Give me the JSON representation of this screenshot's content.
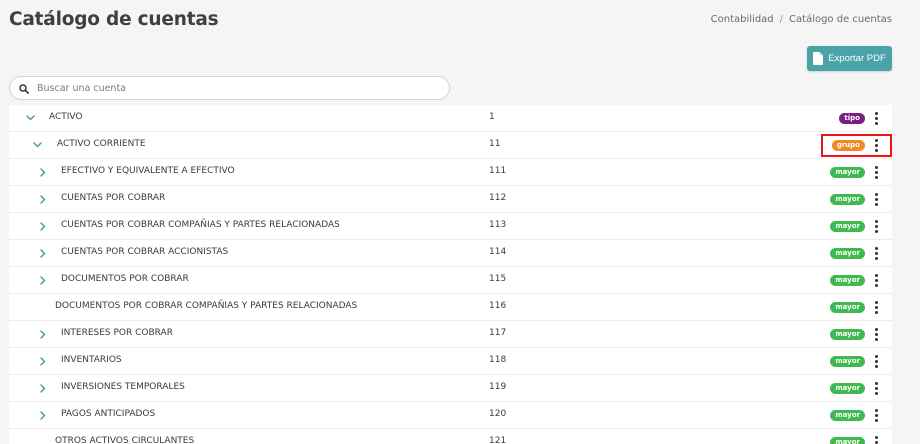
{
  "header": {
    "title": "Catálogo de cuentas",
    "breadcrumb": [
      "Contabilidad",
      "Catálogo de cuentas"
    ],
    "breadcrumb_sep": "/"
  },
  "toolbar": {
    "export_label": "Exportar PDF"
  },
  "search": {
    "placeholder": "Buscar una cuenta",
    "value": ""
  },
  "badge_colors": {
    "tipo": "#7a1f86",
    "grupo": "#f08a24",
    "mayor": "#3fb950"
  },
  "accent": "#4aa3a6",
  "rows": [
    {
      "name": "ACTIVO",
      "code": "1",
      "badge": "tipo",
      "level": 0,
      "chevron": "down"
    },
    {
      "name": "ACTIVO CORRIENTE",
      "code": "11",
      "badge": "grupo",
      "level": 1,
      "chevron": "down"
    },
    {
      "name": "EFECTIVO Y EQUIVALENTE A EFECTIVO",
      "code": "111",
      "badge": "mayor",
      "level": 2,
      "chevron": "right"
    },
    {
      "name": "CUENTAS POR COBRAR",
      "code": "112",
      "badge": "mayor",
      "level": 2,
      "chevron": "right"
    },
    {
      "name": "CUENTAS POR COBRAR COMPAÑIAS Y PARTES RELACIONADAS",
      "code": "113",
      "badge": "mayor",
      "level": 2,
      "chevron": "right"
    },
    {
      "name": "CUENTAS POR COBRAR ACCIONISTAS",
      "code": "114",
      "badge": "mayor",
      "level": 2,
      "chevron": "right"
    },
    {
      "name": "DOCUMENTOS POR COBRAR",
      "code": "115",
      "badge": "mayor",
      "level": 2,
      "chevron": "right"
    },
    {
      "name": "DOCUMENTOS POR COBRAR COMPAÑIAS Y PARTES RELACIONADAS",
      "code": "116",
      "badge": "mayor",
      "level": 2,
      "chevron": "none"
    },
    {
      "name": "INTERESES POR COBRAR",
      "code": "117",
      "badge": "mayor",
      "level": 2,
      "chevron": "right"
    },
    {
      "name": "INVENTARIOS",
      "code": "118",
      "badge": "mayor",
      "level": 2,
      "chevron": "right"
    },
    {
      "name": "INVERSIONES TEMPORALES",
      "code": "119",
      "badge": "mayor",
      "level": 2,
      "chevron": "right"
    },
    {
      "name": "PAGOS ANTICIPADOS",
      "code": "120",
      "badge": "mayor",
      "level": 2,
      "chevron": "right"
    },
    {
      "name": "OTROS ACTIVOS CIRCULANTES",
      "code": "121",
      "badge": "mayor",
      "level": 2,
      "chevron": "none"
    }
  ]
}
